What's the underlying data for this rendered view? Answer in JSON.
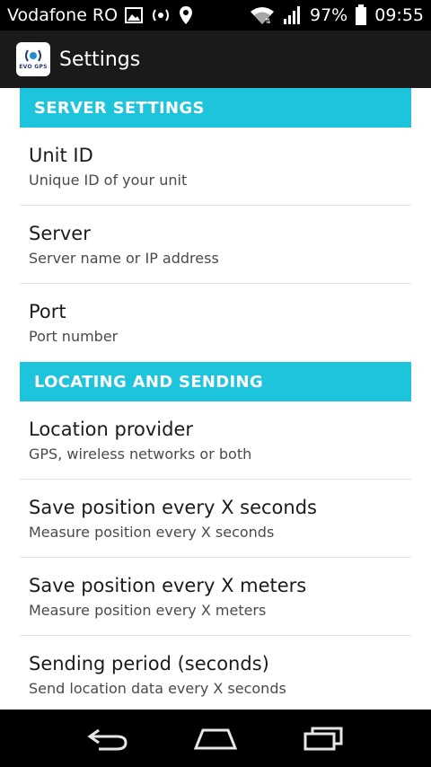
{
  "status_bar": {
    "carrier": "Vodafone RO",
    "battery": "97%",
    "time": "09:55",
    "icons": [
      "image-icon",
      "broadcast-icon",
      "location-icon",
      "wifi-icon",
      "signal-icon",
      "battery-icon"
    ]
  },
  "action_bar": {
    "app_icon_text": "EVO GPS",
    "title": "Settings"
  },
  "sections": [
    {
      "header": "SERVER SETTINGS",
      "items": [
        {
          "title": "Unit ID",
          "summary": "Unique ID of your unit"
        },
        {
          "title": "Server",
          "summary": "Server name or IP address"
        },
        {
          "title": "Port",
          "summary": "Port number"
        }
      ]
    },
    {
      "header": "LOCATING AND SENDING",
      "items": [
        {
          "title": "Location provider",
          "summary": "GPS, wireless networks or both"
        },
        {
          "title": "Save position every X seconds",
          "summary": "Measure position every X seconds"
        },
        {
          "title": "Save position every X meters",
          "summary": "Measure position every X meters"
        },
        {
          "title": "Sending period (seconds)",
          "summary": "Send location data every X seconds"
        }
      ]
    }
  ],
  "colors": {
    "section_header": "#1ec3dc",
    "action_bar": "#1a1a1a",
    "status_bar": "#000000"
  },
  "nav_icons": [
    "back-icon",
    "home-icon",
    "recent-apps-icon"
  ]
}
